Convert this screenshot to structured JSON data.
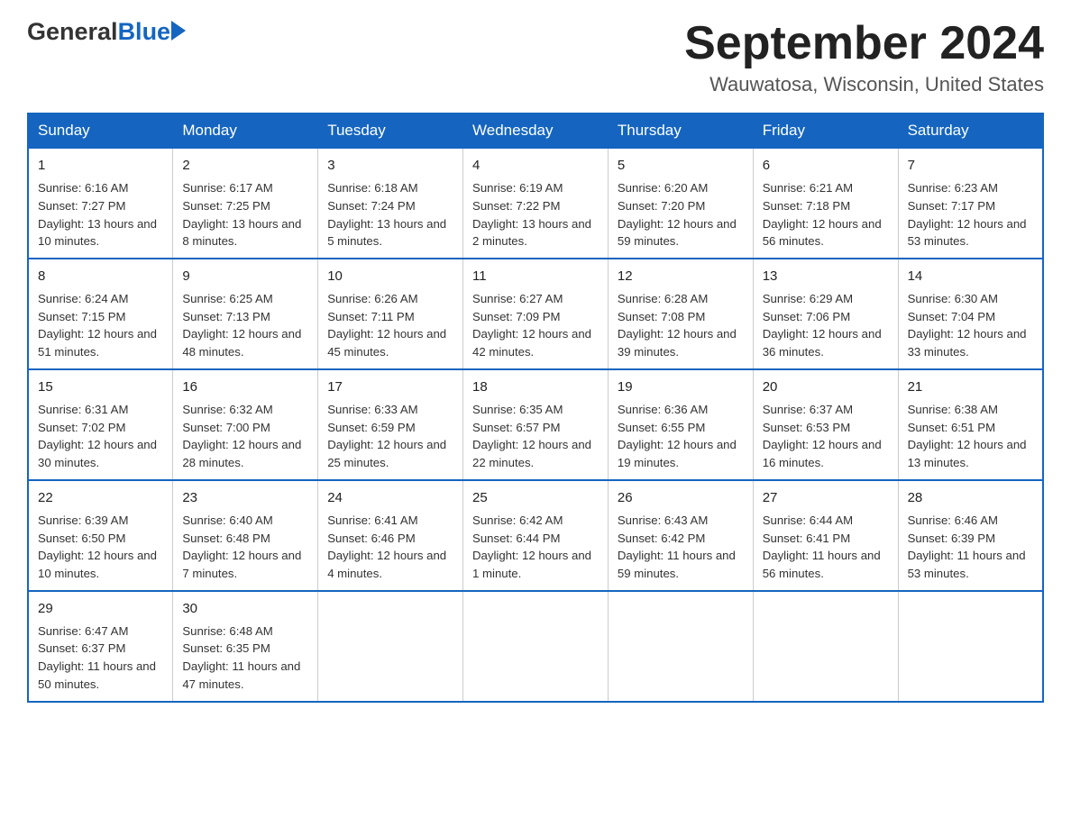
{
  "header": {
    "logo_general": "General",
    "logo_blue": "Blue",
    "month_title": "September 2024",
    "location": "Wauwatosa, Wisconsin, United States"
  },
  "days_of_week": [
    "Sunday",
    "Monday",
    "Tuesday",
    "Wednesday",
    "Thursday",
    "Friday",
    "Saturday"
  ],
  "weeks": [
    [
      {
        "day": "1",
        "sunrise": "6:16 AM",
        "sunset": "7:27 PM",
        "daylight": "13 hours and 10 minutes."
      },
      {
        "day": "2",
        "sunrise": "6:17 AM",
        "sunset": "7:25 PM",
        "daylight": "13 hours and 8 minutes."
      },
      {
        "day": "3",
        "sunrise": "6:18 AM",
        "sunset": "7:24 PM",
        "daylight": "13 hours and 5 minutes."
      },
      {
        "day": "4",
        "sunrise": "6:19 AM",
        "sunset": "7:22 PM",
        "daylight": "13 hours and 2 minutes."
      },
      {
        "day": "5",
        "sunrise": "6:20 AM",
        "sunset": "7:20 PM",
        "daylight": "12 hours and 59 minutes."
      },
      {
        "day": "6",
        "sunrise": "6:21 AM",
        "sunset": "7:18 PM",
        "daylight": "12 hours and 56 minutes."
      },
      {
        "day": "7",
        "sunrise": "6:23 AM",
        "sunset": "7:17 PM",
        "daylight": "12 hours and 53 minutes."
      }
    ],
    [
      {
        "day": "8",
        "sunrise": "6:24 AM",
        "sunset": "7:15 PM",
        "daylight": "12 hours and 51 minutes."
      },
      {
        "day": "9",
        "sunrise": "6:25 AM",
        "sunset": "7:13 PM",
        "daylight": "12 hours and 48 minutes."
      },
      {
        "day": "10",
        "sunrise": "6:26 AM",
        "sunset": "7:11 PM",
        "daylight": "12 hours and 45 minutes."
      },
      {
        "day": "11",
        "sunrise": "6:27 AM",
        "sunset": "7:09 PM",
        "daylight": "12 hours and 42 minutes."
      },
      {
        "day": "12",
        "sunrise": "6:28 AM",
        "sunset": "7:08 PM",
        "daylight": "12 hours and 39 minutes."
      },
      {
        "day": "13",
        "sunrise": "6:29 AM",
        "sunset": "7:06 PM",
        "daylight": "12 hours and 36 minutes."
      },
      {
        "day": "14",
        "sunrise": "6:30 AM",
        "sunset": "7:04 PM",
        "daylight": "12 hours and 33 minutes."
      }
    ],
    [
      {
        "day": "15",
        "sunrise": "6:31 AM",
        "sunset": "7:02 PM",
        "daylight": "12 hours and 30 minutes."
      },
      {
        "day": "16",
        "sunrise": "6:32 AM",
        "sunset": "7:00 PM",
        "daylight": "12 hours and 28 minutes."
      },
      {
        "day": "17",
        "sunrise": "6:33 AM",
        "sunset": "6:59 PM",
        "daylight": "12 hours and 25 minutes."
      },
      {
        "day": "18",
        "sunrise": "6:35 AM",
        "sunset": "6:57 PM",
        "daylight": "12 hours and 22 minutes."
      },
      {
        "day": "19",
        "sunrise": "6:36 AM",
        "sunset": "6:55 PM",
        "daylight": "12 hours and 19 minutes."
      },
      {
        "day": "20",
        "sunrise": "6:37 AM",
        "sunset": "6:53 PM",
        "daylight": "12 hours and 16 minutes."
      },
      {
        "day": "21",
        "sunrise": "6:38 AM",
        "sunset": "6:51 PM",
        "daylight": "12 hours and 13 minutes."
      }
    ],
    [
      {
        "day": "22",
        "sunrise": "6:39 AM",
        "sunset": "6:50 PM",
        "daylight": "12 hours and 10 minutes."
      },
      {
        "day": "23",
        "sunrise": "6:40 AM",
        "sunset": "6:48 PM",
        "daylight": "12 hours and 7 minutes."
      },
      {
        "day": "24",
        "sunrise": "6:41 AM",
        "sunset": "6:46 PM",
        "daylight": "12 hours and 4 minutes."
      },
      {
        "day": "25",
        "sunrise": "6:42 AM",
        "sunset": "6:44 PM",
        "daylight": "12 hours and 1 minute."
      },
      {
        "day": "26",
        "sunrise": "6:43 AM",
        "sunset": "6:42 PM",
        "daylight": "11 hours and 59 minutes."
      },
      {
        "day": "27",
        "sunrise": "6:44 AM",
        "sunset": "6:41 PM",
        "daylight": "11 hours and 56 minutes."
      },
      {
        "day": "28",
        "sunrise": "6:46 AM",
        "sunset": "6:39 PM",
        "daylight": "11 hours and 53 minutes."
      }
    ],
    [
      {
        "day": "29",
        "sunrise": "6:47 AM",
        "sunset": "6:37 PM",
        "daylight": "11 hours and 50 minutes."
      },
      {
        "day": "30",
        "sunrise": "6:48 AM",
        "sunset": "6:35 PM",
        "daylight": "11 hours and 47 minutes."
      },
      null,
      null,
      null,
      null,
      null
    ]
  ],
  "labels": {
    "sunrise": "Sunrise:",
    "sunset": "Sunset:",
    "daylight": "Daylight:"
  }
}
